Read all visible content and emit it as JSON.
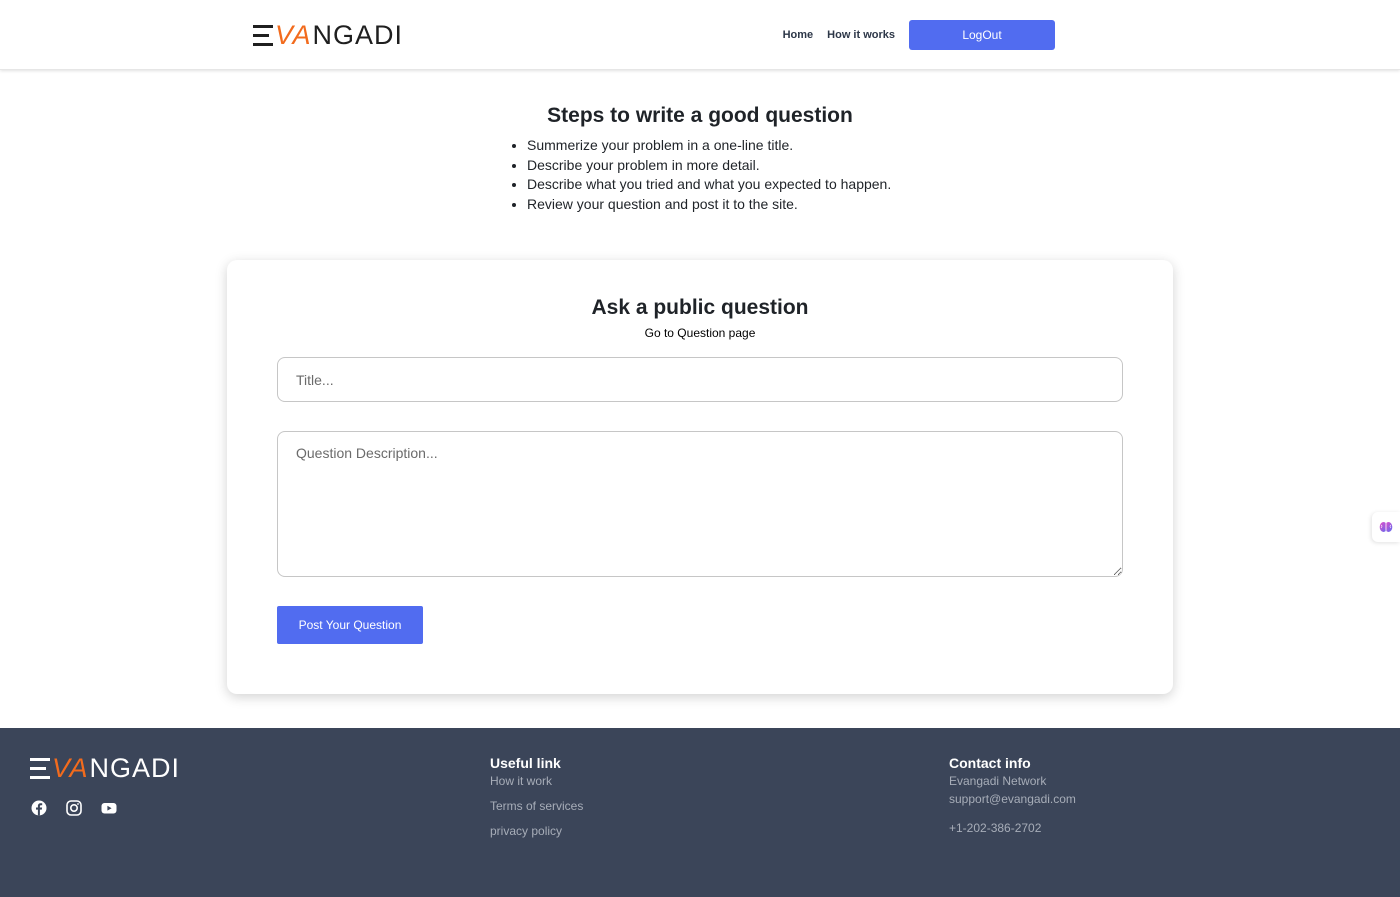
{
  "header": {
    "logo": {
      "e": "E",
      "va": "VA",
      "rest": "NGADI"
    },
    "nav": {
      "home": "Home",
      "how_it_works": "How it works"
    },
    "logout_label": "LogOut",
    "accent": "#516cf0"
  },
  "steps": {
    "title": "Steps to write a good question",
    "items": [
      "Summerize your problem in a one-line title.",
      "Describe your problem in more detail.",
      "Describe what you tried and what you expected to happen.",
      "Review your question and post it to the site."
    ]
  },
  "ask": {
    "title": "Ask a public question",
    "go_to_label": "Go to Question page",
    "title_placeholder": "Title...",
    "description_placeholder": "Question Description...",
    "post_label": "Post Your Question"
  },
  "footer": {
    "logo": {
      "e": "E",
      "va": "VA",
      "rest": "NGADI"
    },
    "socials": [
      "facebook-icon",
      "instagram-icon",
      "youtube-icon"
    ],
    "useful": {
      "title": "Useful link",
      "links": [
        "How it work",
        "Terms of services",
        "privacy policy"
      ]
    },
    "contact": {
      "title": "Contact info",
      "items": [
        "Evangadi Network",
        "support@evangadi.com",
        "+1-202-386-2702"
      ]
    },
    "background": "#3b4559",
    "logo_accent": "#f26b1d"
  }
}
